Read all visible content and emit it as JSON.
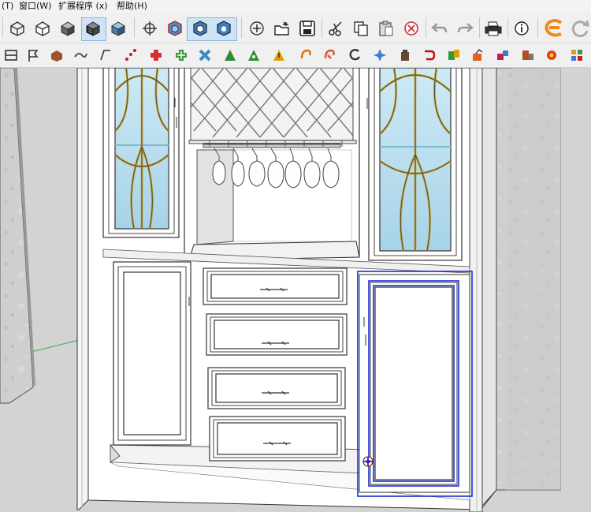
{
  "menu": {
    "items": [
      {
        "id": "tools",
        "label": "(T)"
      },
      {
        "id": "window",
        "label": "窗口(W)"
      },
      {
        "id": "extensions",
        "label": "扩展程序 (x)"
      },
      {
        "id": "help",
        "label": "帮助(H)"
      }
    ]
  },
  "toolbar_main": {
    "tools": [
      "wireframe-style-icon",
      "hidden-line-style-icon",
      "shaded-style-icon",
      "shaded-textures-style-icon",
      "monochrome-style-icon",
      "xray-crosshair-icon",
      "component-blue-icon",
      "component-active-icon",
      "component-outline-icon",
      "add-location-icon",
      "open-file-icon",
      "save-icon",
      "cut-icon",
      "copy-icon",
      "paste-icon",
      "erase-icon",
      "undo-icon",
      "redo-icon",
      "print-icon",
      "model-info-icon",
      "extension-logo-icon",
      "refresh-icon"
    ]
  },
  "toolbar_plugins": {
    "tools": [
      "plugin-tool-1-icon",
      "plugin-tool-2-icon",
      "plugin-tool-3-icon",
      "plugin-tool-4-icon",
      "plugin-tool-5-icon",
      "plugin-tool-6-icon",
      "plugin-tool-7-icon",
      "plugin-tool-8-icon",
      "plugin-tool-9-icon",
      "plugin-tool-10-icon",
      "plugin-tool-11-icon",
      "plugin-tool-12-icon",
      "plugin-tool-13-icon",
      "plugin-tool-14-icon",
      "plugin-tool-15-icon",
      "plugin-tool-16-icon",
      "plugin-tool-17-icon",
      "plugin-tool-18-icon",
      "plugin-tool-19-icon",
      "plugin-tool-20-icon",
      "plugin-tool-21-icon",
      "plugin-tool-22-icon",
      "plugin-tool-23-icon",
      "plugin-tool-24-icon",
      "plugin-tool-25-icon",
      "plugin-tool-26-icon"
    ]
  },
  "viewport": {
    "model": "wine-cabinet",
    "selected": "right-door",
    "colors": {
      "selection": "#1a2fd6",
      "glass": "#bfe0ef",
      "lead": "#b8962e",
      "cabinet": "#ffffff",
      "wall": "#d3d3d3",
      "axis_green": "#3aa84a"
    }
  }
}
